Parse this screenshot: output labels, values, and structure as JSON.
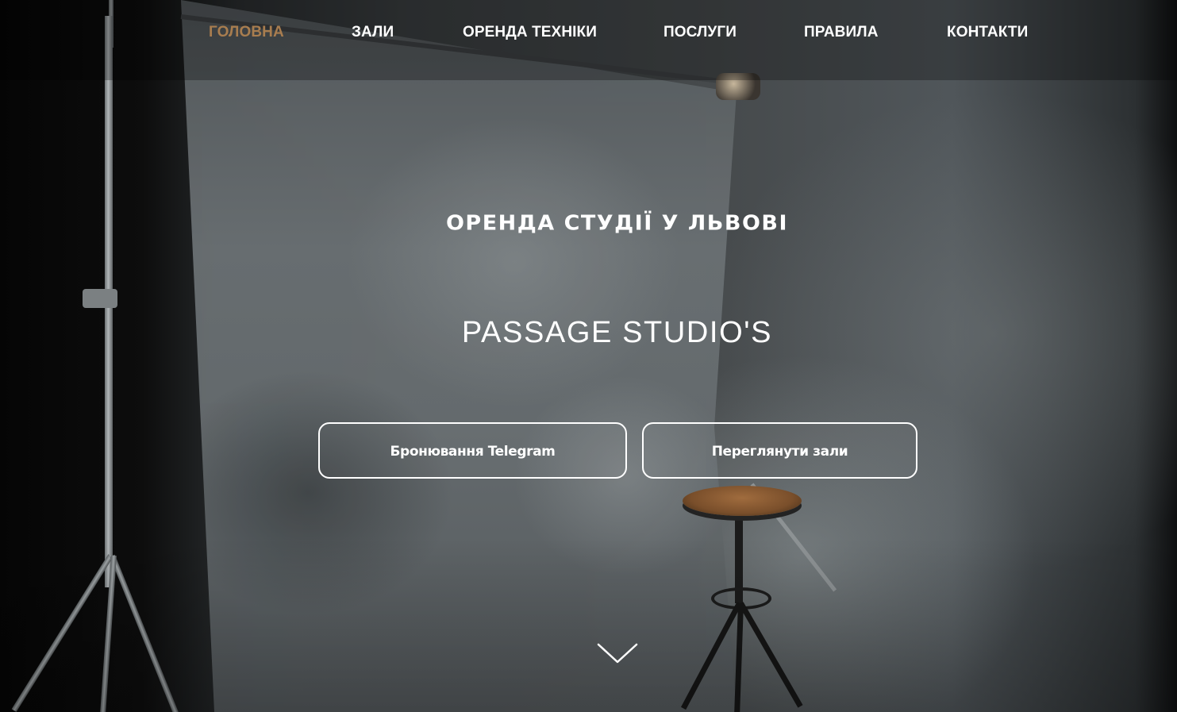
{
  "nav": {
    "items": [
      {
        "label": "ГОЛОВНА",
        "active": true
      },
      {
        "label": "ЗАЛИ",
        "active": false
      },
      {
        "label": "ОРЕНДА ТЕХНІКИ",
        "active": false
      },
      {
        "label": "ПОСЛУГИ",
        "active": false
      },
      {
        "label": "ПРАВИЛА",
        "active": false
      },
      {
        "label": "КОНТАКТИ",
        "active": false
      }
    ],
    "active_color": "#a87d4f"
  },
  "hero": {
    "subtitle": "ОРЕНДА СТУДІЇ У ЛЬВОВІ",
    "title": "PASSAGE STUDIO'S",
    "buttons": {
      "telegram": "Бронювання Telegram",
      "halls": "Переглянути зали"
    },
    "scroll_icon": "chevron-down-icon"
  }
}
